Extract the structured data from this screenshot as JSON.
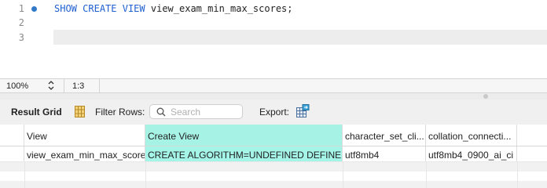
{
  "editor": {
    "lines": [
      {
        "num": "1",
        "keyword1": "SHOW",
        "keyword2": "CREATE",
        "keyword3": "VIEW",
        "rest": "view_exam_min_max_scores;"
      },
      {
        "num": "2"
      },
      {
        "num": "3"
      }
    ]
  },
  "status_bar": {
    "zoom": "100%",
    "cursor_position": "1:3"
  },
  "toolbar": {
    "result_grid_label": "Result Grid",
    "filter_rows_label": "Filter Rows:",
    "search_placeholder": "Search",
    "export_label": "Export:"
  },
  "table": {
    "columns": [
      "View",
      "Create View",
      "character_set_cli...",
      "collation_connecti..."
    ],
    "rows": [
      [
        "view_exam_min_max_scores",
        "CREATE ALGORITHM=UNDEFINED DEFINER...",
        "utf8mb4",
        "utf8mb4_0900_ai_ci"
      ]
    ],
    "highlight_color": "#a4f4e8"
  },
  "colors": {
    "keyword": "#1f5fd0",
    "breakpoint_dot": "#3478c8"
  }
}
